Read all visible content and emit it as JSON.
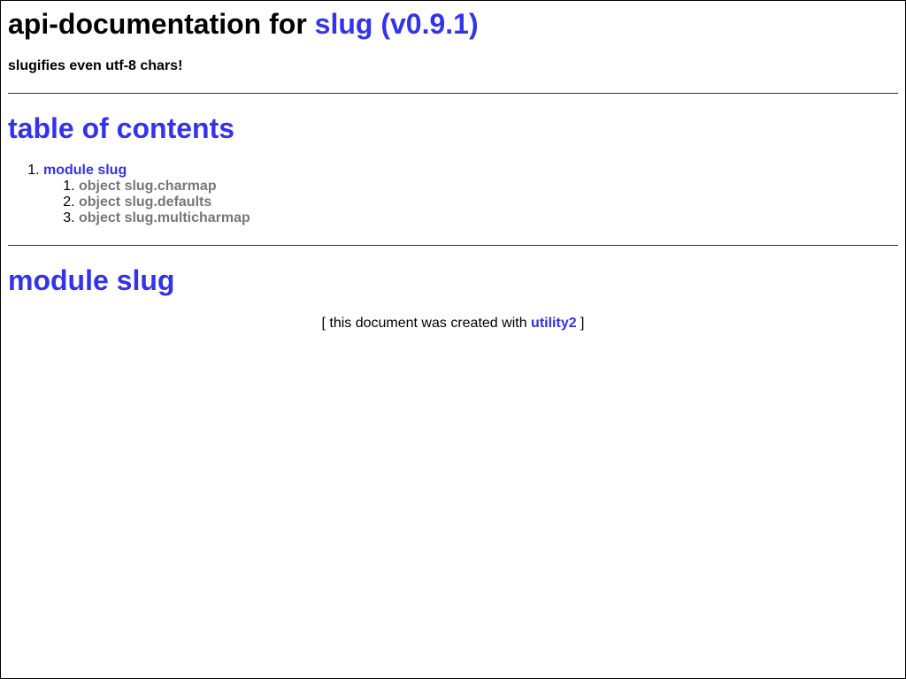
{
  "header": {
    "title_prefix": "api-documentation for ",
    "title_link": "slug (v0.9.1)",
    "description": "slugifies even utf-8 chars!"
  },
  "toc": {
    "heading": "table of contents",
    "items": [
      {
        "label": "module slug",
        "children": [
          {
            "label": "object slug.charmap"
          },
          {
            "label": "object slug.defaults"
          },
          {
            "label": "object slug.multicharmap"
          }
        ]
      }
    ]
  },
  "module": {
    "heading": "module slug"
  },
  "footer": {
    "open": "[ this document was created with ",
    "link": "utility2",
    "close": " ]"
  },
  "colors": {
    "link": "#3333ee",
    "muted_link": "#777777",
    "text": "#000000"
  }
}
